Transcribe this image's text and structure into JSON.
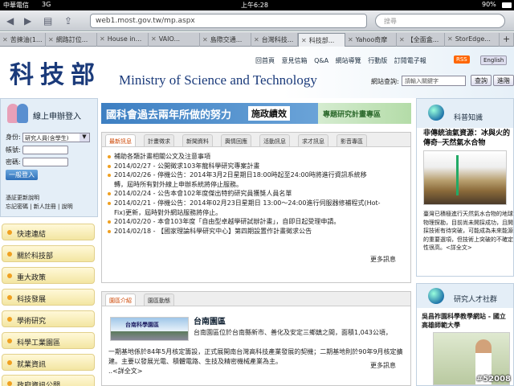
{
  "status_bar": {
    "carrier": "中華電信",
    "network": "3G",
    "time": "上午6:28",
    "battery": "90%"
  },
  "browser": {
    "url": "web1.most.gov.tw/mp.aspx",
    "search_placeholder": "搜尋",
    "tabs": [
      {
        "label": "苦揀油(1..."
      },
      {
        "label": "網路訂位..."
      },
      {
        "label": "House in..."
      },
      {
        "label": "VAIO..."
      },
      {
        "label": "島際交通..."
      },
      {
        "label": "台灣科技..."
      },
      {
        "label": "科技部..."
      },
      {
        "label": "Yahoo奇摩"
      },
      {
        "label": "【全面盒..."
      },
      {
        "label": "StorEdge..."
      }
    ]
  },
  "header": {
    "logo_zh": "科技部",
    "logo_en": "Ministry of Science and Technology",
    "nav": [
      "回首頁",
      "意見信箱",
      "Q&A",
      "網站導覽",
      "行動版",
      "訂閱電子報"
    ],
    "rss": "RSS",
    "english": "English",
    "search_label": "網站查詢:",
    "search_placeholder": "請輸入關鍵字",
    "search_button": "查詢",
    "advanced_button": "進階"
  },
  "login": {
    "title": "線上申辦登入",
    "role_label": "身份:",
    "role_value": "研究人員(含學生)",
    "account_label": "帳號:",
    "password_label": "密碼:",
    "login_button": "一般登入",
    "link1": "憑証更新說明",
    "link2": "忘記密碼 | 新人註冊 | 說明"
  },
  "menu": [
    "快速連結",
    "關於科技部",
    "重大政策",
    "科技發展",
    "學術研究",
    "科學工業園區",
    "就業資訊",
    "政府資訊公開"
  ],
  "banner": {
    "main": "國科會過去兩年所做的努力",
    "highlight": "施政績效",
    "side": "專題研究計畫專區"
  },
  "news": {
    "tabs": [
      "最新訊息",
      "計畫徵求",
      "新聞資料",
      "輿情回應",
      "活動訊息",
      "求才訊息",
      "影音專區"
    ],
    "items": [
      "補助各類計畫相關公文及注意事項",
      "2014/02/27 - 公開徵求103年龍科學研究專案計畫",
      "2014/02/26 - 停機公告：2014年3月2日星期日18:00時起至24:00時將進行資訊系統移",
      "轉，屆時所有對外線上申辦系統將停止服務。",
      "2014/02/24 - 公告本會102年度傑出特約研究員獲獎人員名單",
      "2014/02/21 - 停機公告：2014年02月23日星期日 13:00～24:00進行伺服器修補程式(Hot-",
      "Fix)更新，屆時對外網站服務將停止。",
      "2014/02/20 - 本會103年度「自由型卓越學研試辦計畫」，自即日起受理申請。",
      "2014/02/18 - 【國家理論科學研究中心】第四期設置作計畫徵求公告"
    ],
    "more": "更多訊息"
  },
  "park": {
    "tabs": [
      "園區介紹",
      "園區動態"
    ],
    "image_caption": "台南科學園區",
    "title": "台南園區",
    "desc": "台南園區位於台南縣新市、善化及安定三鄉鎮之間，面積1,043公頃，",
    "desc2": "一期基地係於84年5月核定籌設，正式展開南台灣高科技產業發展的契機；二期基地則於90年9月核定擴建。主要以發展光電、積體電路、生技及精密機械產業為主。",
    "read_more": "..<詳全文>",
    "more": "更多訊息"
  },
  "science": {
    "title": "科普知識",
    "subtitle": "非傳統油氣資源：冰與火的傳奇─天然氣水合物",
    "desc": "臺灣已積極進行天然氣水合物的地球物理探勘，目前尚未開採成功，且開採技術有待突破，可能成為未來能源的重要選項，但技術上突破的不確定性很高。<詳全文>"
  },
  "talent": {
    "title": "研究人才社群",
    "subtitle": "吳昌祚園科學教學網站 - 國立高雄師範大學"
  },
  "watermark": "#52008"
}
